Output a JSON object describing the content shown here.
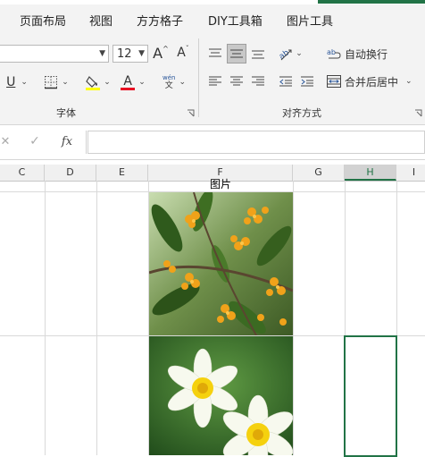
{
  "ribbon": {
    "tabs": [
      "页面布局",
      "视图",
      "方方格子",
      "DIY工具箱",
      "图片工具"
    ],
    "font_size": "12",
    "font_name": "",
    "grow_font_label": "A",
    "shrink_font_label": "A",
    "underline_label": "U",
    "font_color_label": "A",
    "phonetic_top": "wén",
    "phonetic_bottom": "文",
    "wrap_text_label": "自动换行",
    "merge_center_label": "合并后居中",
    "group_font_label": "字体",
    "group_align_label": "对齐方式",
    "highlight_color": "#ffff00",
    "font_color": "#e81123"
  },
  "formula_bar": {
    "fx_label": "fx",
    "value": ""
  },
  "sheet": {
    "columns": [
      "C",
      "D",
      "E",
      "F",
      "G",
      "H",
      "I"
    ],
    "selected_column": "H",
    "cell_f_header": "图片",
    "images": [
      "osmanthus-flowers-image",
      "daffodil-flowers-image"
    ]
  },
  "colors": {
    "accent": "#217346",
    "ribbon_bg": "#f3f3f3",
    "grid_line": "#d9d9d9"
  }
}
